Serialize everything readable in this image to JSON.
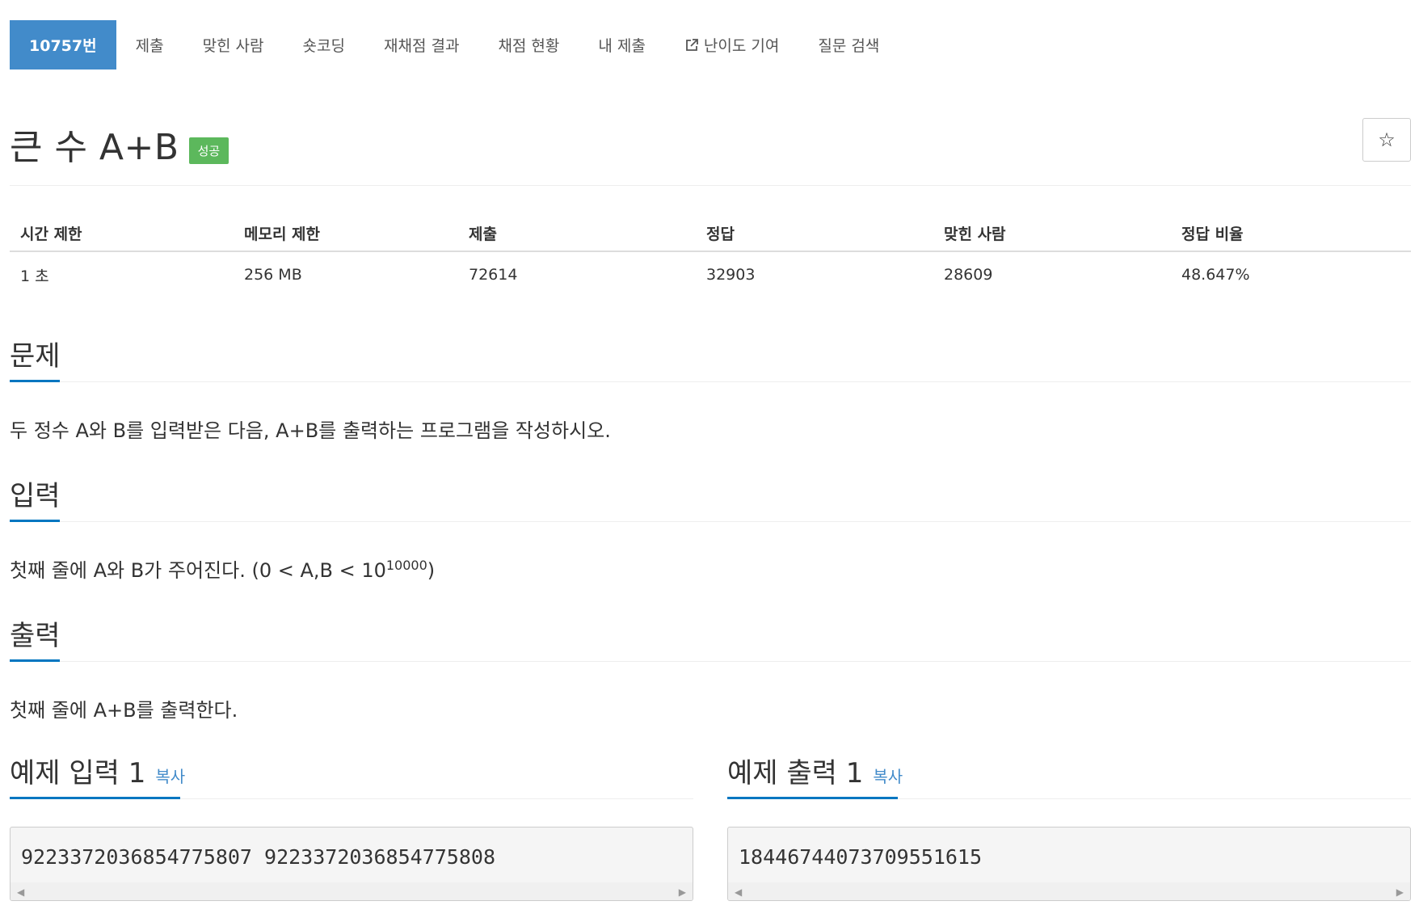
{
  "nav": {
    "items": [
      {
        "label": "10757번",
        "active": true
      },
      {
        "label": "제출"
      },
      {
        "label": "맞힌 사람"
      },
      {
        "label": "숏코딩"
      },
      {
        "label": "재채점 결과"
      },
      {
        "label": "채점 현황"
      },
      {
        "label": "내 제출"
      },
      {
        "label": "난이도 기여",
        "icon": "external-link-icon"
      },
      {
        "label": "질문 검색"
      }
    ]
  },
  "problem": {
    "title": "큰 수 A+B",
    "status_badge": "성공",
    "star_icon": "☆"
  },
  "stats": {
    "headers": [
      "시간 제한",
      "메모리 제한",
      "제출",
      "정답",
      "맞힌 사람",
      "정답 비율"
    ],
    "values": [
      "1 초",
      "256 MB",
      "72614",
      "32903",
      "28609",
      "48.647%"
    ]
  },
  "sections": {
    "problem_heading": "문제",
    "problem_text": "두 정수 A와 B를 입력받은 다음, A+B를 출력하는 프로그램을 작성하시오.",
    "input_heading": "입력",
    "input_text_prefix": "첫째 줄에 A와 B가 주어진다. (0 < A,B < 10",
    "input_text_sup": "10000",
    "input_text_suffix": ")",
    "output_heading": "출력",
    "output_text": "첫째 줄에 A+B를 출력한다."
  },
  "samples": {
    "input_heading": "예제 입력 1",
    "output_heading": "예제 출력 1",
    "copy_label": "복사",
    "input_value": "9223372036854775807 9223372036854775808",
    "output_value": "18446744073709551615"
  },
  "colors": {
    "accent": "#428bca",
    "success": "#5cb85c",
    "heading_underline": "#0076c0"
  }
}
